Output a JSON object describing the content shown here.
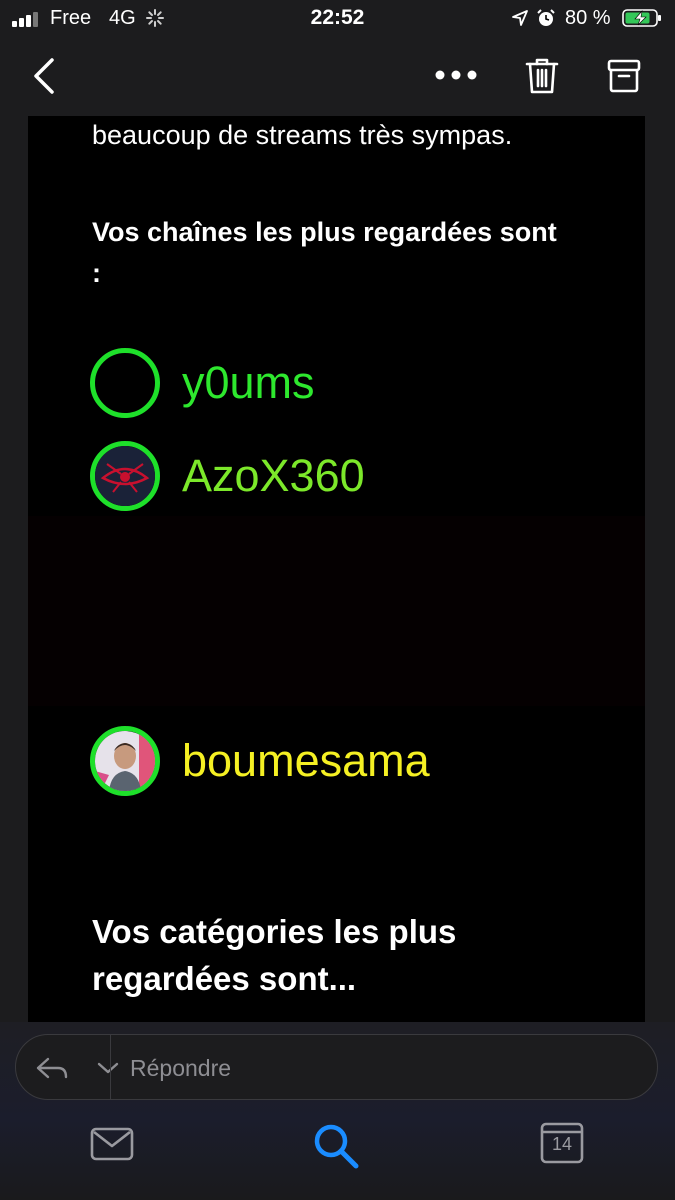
{
  "status_bar": {
    "carrier": "Free",
    "network": "4G",
    "time": "22:52",
    "battery_percent": "80 %",
    "battery_level": 0.8
  },
  "nav": {
    "back_icon": "chevron-left-icon",
    "more_icon": "ellipsis-icon",
    "trash_icon": "trash-icon",
    "archive_icon": "archive-icon"
  },
  "email": {
    "intro_tail": "beaucoup de streams très sympas.",
    "channels_heading": "Vos chaînes les plus regardées sont :",
    "channels": [
      {
        "name": "y0ums",
        "color": "#2ee82e"
      },
      {
        "name": "AzoX360",
        "color": "#7ce82a"
      },
      {
        "name": "boumesama",
        "color": "#f5f023"
      }
    ],
    "categories_heading": "Vos catégories les plus regardées sont..."
  },
  "reply": {
    "placeholder": "Répondre"
  },
  "tabs": {
    "calendar_day": "14"
  },
  "colors": {
    "accent": "#1a8cff",
    "avatar_ring": "#1ee02a"
  }
}
